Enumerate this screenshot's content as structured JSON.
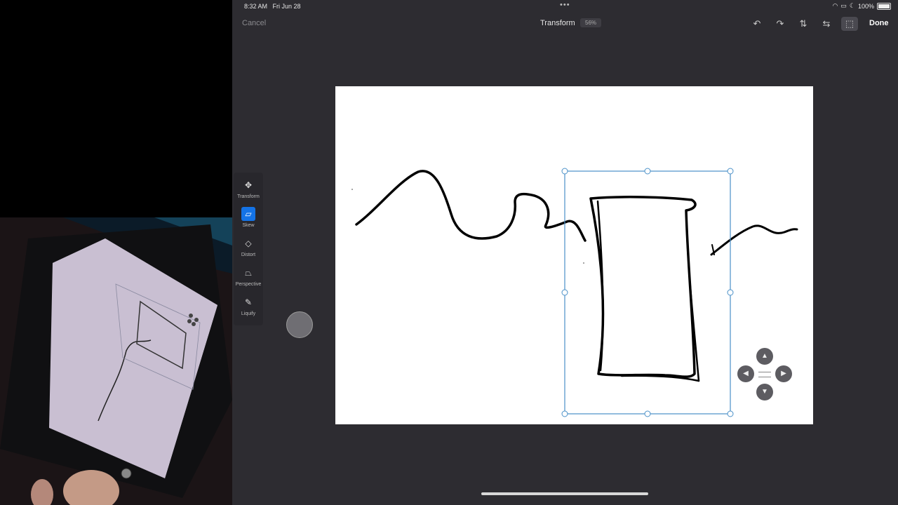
{
  "status_bar": {
    "time": "8:32 AM",
    "date": "Fri Jun 28",
    "battery": "100%",
    "icons": [
      "wifi-icon",
      "screen-mirror-icon",
      "moon-icon",
      "battery-icon"
    ]
  },
  "toolbar": {
    "cancel_label": "Cancel",
    "title": "Transform",
    "zoom": "56%",
    "done_label": "Done",
    "icons": [
      "undo-icon",
      "redo-icon",
      "flip-vertical-icon",
      "flip-horizontal-icon",
      "crop-transform-icon"
    ]
  },
  "side_tools": {
    "items": [
      {
        "label": "Transform",
        "icon": "move-arrows-icon",
        "active": false
      },
      {
        "label": "Skew",
        "icon": "skew-icon",
        "active": true
      },
      {
        "label": "Distort",
        "icon": "distort-icon",
        "active": false
      },
      {
        "label": "Perspective",
        "icon": "perspective-icon",
        "active": false
      },
      {
        "label": "Liquify",
        "icon": "liquify-icon",
        "active": false
      }
    ]
  },
  "nudge_control": {
    "icons": [
      "arrow-up-icon",
      "arrow-left-icon",
      "arrow-right-icon",
      "arrow-down-icon"
    ]
  },
  "colors": {
    "app_background": "#2d2c31",
    "accent": "#1473e6",
    "selection": "#4a90c8",
    "canvas": "#ffffff"
  }
}
